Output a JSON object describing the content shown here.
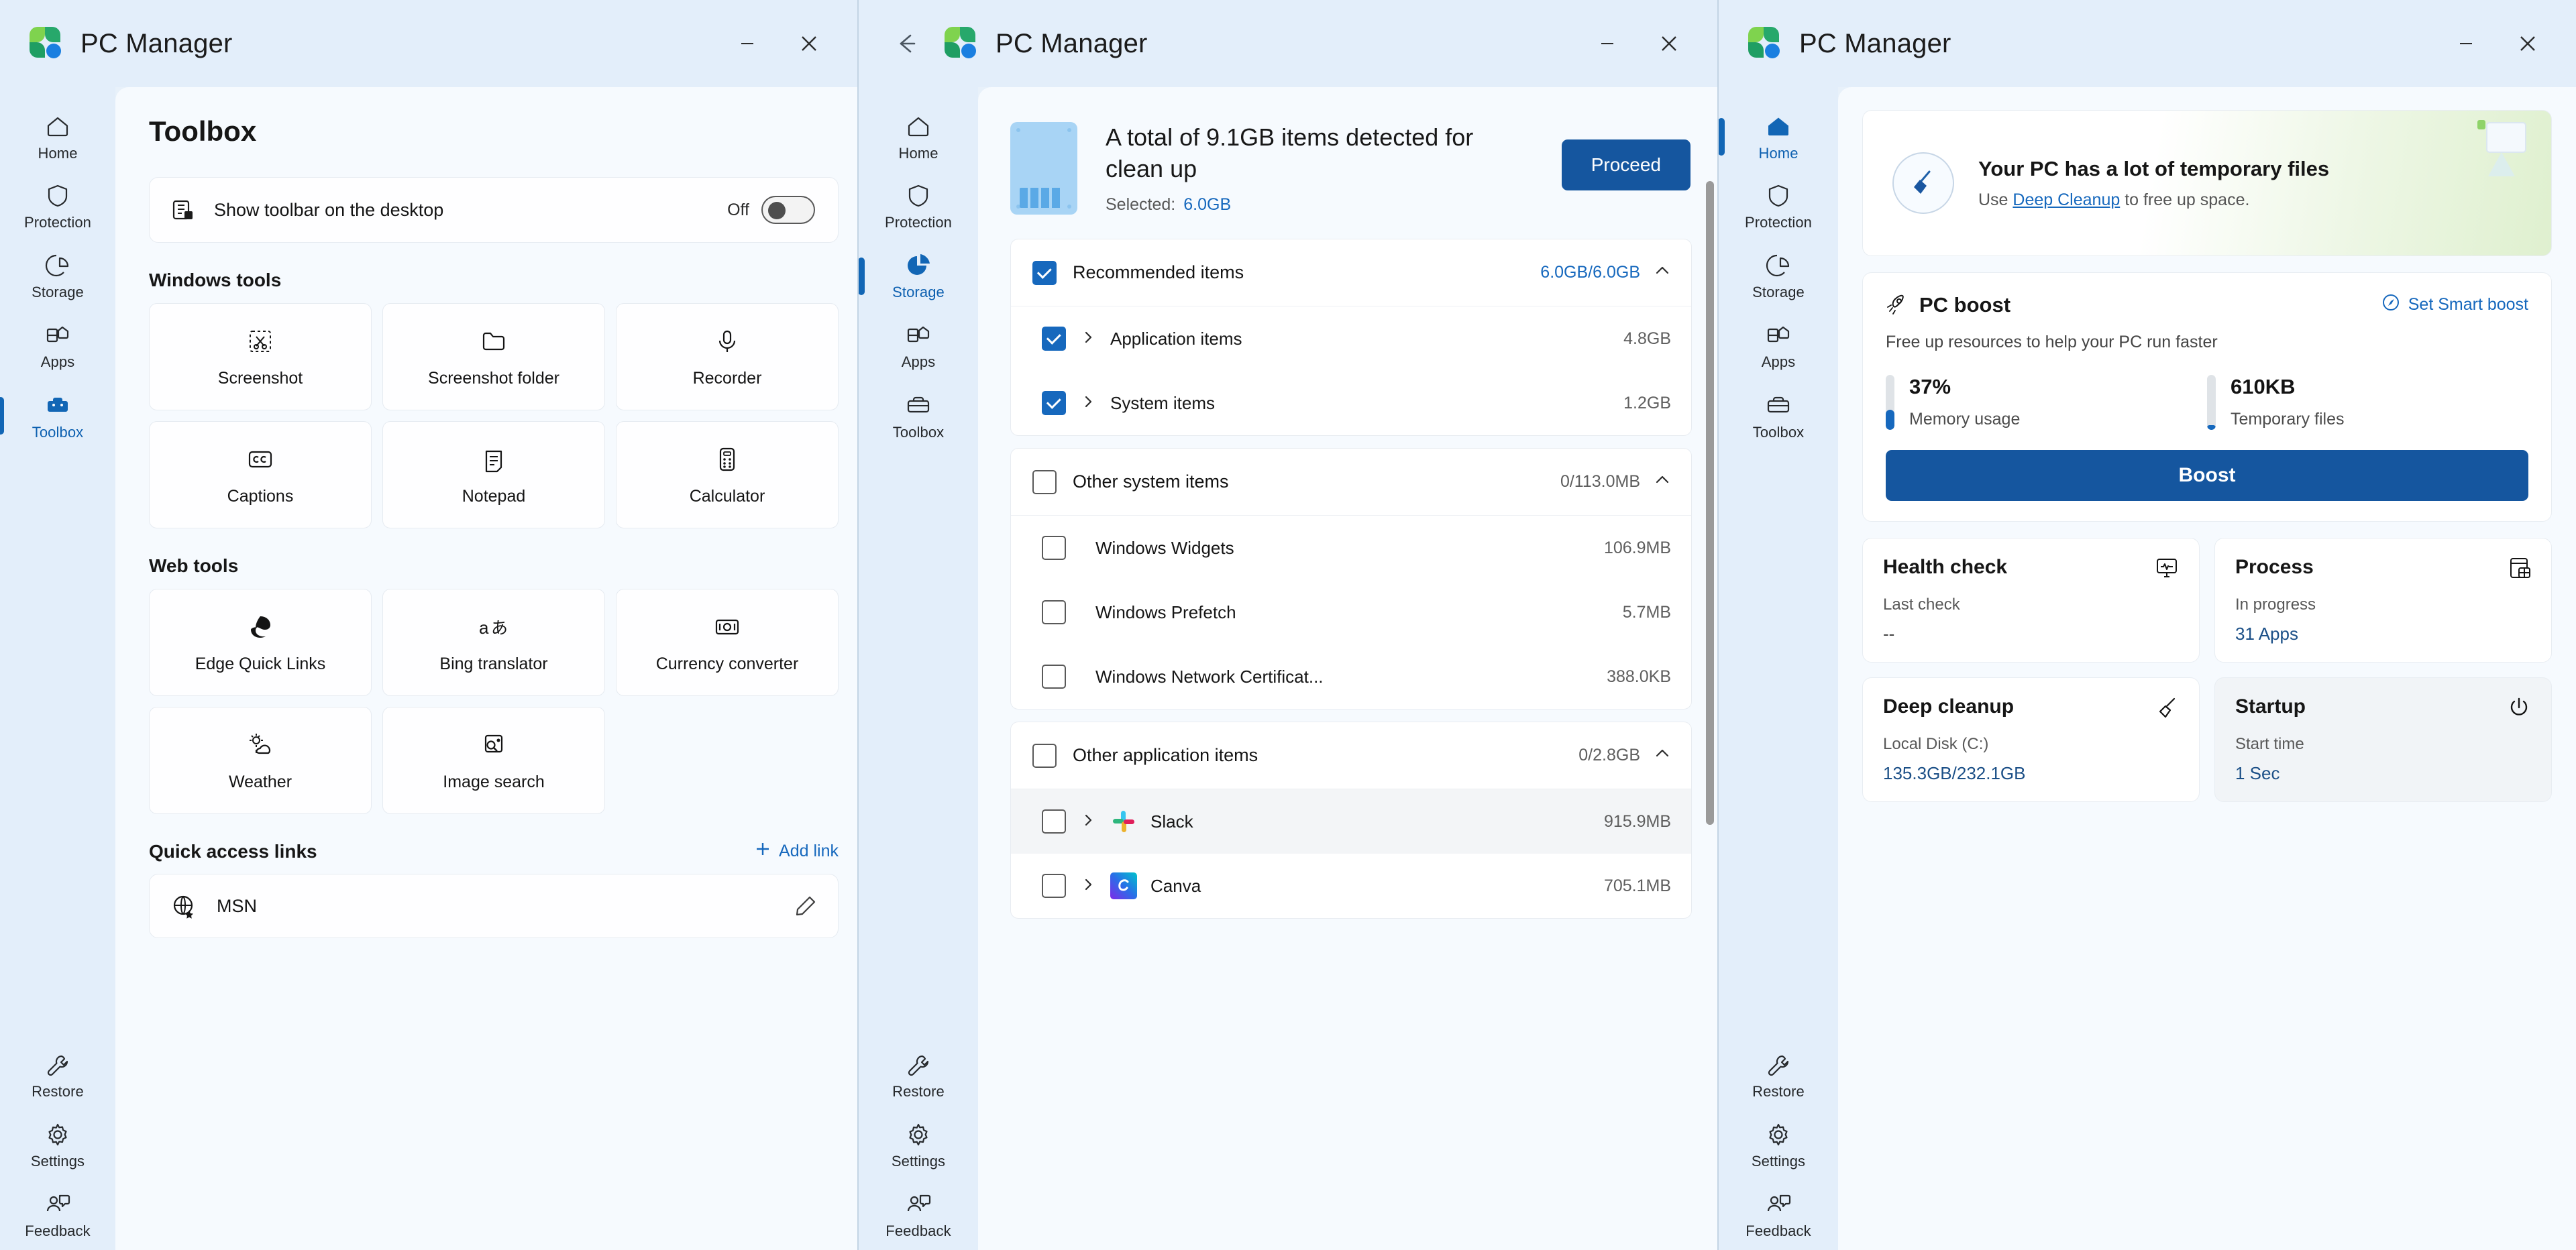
{
  "app": {
    "title": "PC Manager",
    "logo_icon": "pc-manager-logo-icon"
  },
  "window_buttons": {
    "minimize": "minimize-icon",
    "close": "close-icon",
    "back": "back-arrow-icon"
  },
  "nav": {
    "items": [
      {
        "label": "Home",
        "icon": "home-icon"
      },
      {
        "label": "Protection",
        "icon": "shield-icon"
      },
      {
        "label": "Storage",
        "icon": "pie-chart-icon"
      },
      {
        "label": "Apps",
        "icon": "apps-grid-icon"
      },
      {
        "label": "Toolbox",
        "icon": "toolbox-icon"
      }
    ],
    "bottom_items": [
      {
        "label": "Restore",
        "icon": "wrench-icon"
      },
      {
        "label": "Settings",
        "icon": "gear-icon"
      },
      {
        "label": "Feedback",
        "icon": "feedback-icon"
      }
    ]
  },
  "window1": {
    "active_nav": "Toolbox",
    "page_title": "Toolbox",
    "toolbar_setting": {
      "icon": "toolbar-desktop-icon",
      "label": "Show toolbar on the desktop",
      "state_label": "Off",
      "enabled": false
    },
    "windows_tools": {
      "heading": "Windows tools",
      "tiles": [
        {
          "label": "Screenshot",
          "icon": "snip-scissors-icon"
        },
        {
          "label": "Screenshot folder",
          "icon": "folder-icon"
        },
        {
          "label": "Recorder",
          "icon": "microphone-icon"
        },
        {
          "label": "Captions",
          "icon": "closed-captions-icon"
        },
        {
          "label": "Notepad",
          "icon": "notepad-icon"
        },
        {
          "label": "Calculator",
          "icon": "calculator-icon"
        }
      ]
    },
    "web_tools": {
      "heading": "Web tools",
      "tiles": [
        {
          "label": "Edge Quick Links",
          "icon": "edge-browser-icon"
        },
        {
          "label": "Bing translator",
          "icon": "translate-icon"
        },
        {
          "label": "Currency converter",
          "icon": "banknote-icon"
        },
        {
          "label": "Weather",
          "icon": "weather-sun-cloud-icon"
        },
        {
          "label": "Image search",
          "icon": "image-search-icon"
        }
      ]
    },
    "quick_access": {
      "heading": "Quick access links",
      "add_label": "Add link",
      "add_icon": "plus-icon",
      "links": [
        {
          "name": "MSN",
          "icon": "globe-favorite-icon",
          "edit_icon": "pencil-icon"
        }
      ]
    }
  },
  "window2": {
    "active_nav": "Storage",
    "summary": {
      "heading": "A total of 9.1GB items detected for clean up",
      "selected_label": "Selected:",
      "selected_value": "6.0GB",
      "proceed_label": "Proceed",
      "disk_icon": "ssd-drive-icon"
    },
    "groups": [
      {
        "label": "Recommended items",
        "size": "6.0GB/6.0GB",
        "checked": true,
        "size_highlight": true,
        "expanded": true,
        "children": [
          {
            "label": "Application items",
            "size": "4.8GB",
            "checked": true,
            "expandable": true
          },
          {
            "label": "System items",
            "size": "1.2GB",
            "checked": true,
            "expandable": true
          }
        ]
      },
      {
        "label": "Other system items",
        "size": "0/113.0MB",
        "checked": false,
        "size_highlight": false,
        "expanded": true,
        "children": [
          {
            "label": "Windows Widgets",
            "size": "106.9MB",
            "checked": false,
            "expandable": false
          },
          {
            "label": "Windows Prefetch",
            "size": "5.7MB",
            "checked": false,
            "expandable": false
          },
          {
            "label": "Windows Network Certificat...",
            "size": "388.0KB",
            "checked": false,
            "expandable": false
          }
        ]
      },
      {
        "label": "Other application items",
        "size": "0/2.8GB",
        "checked": false,
        "size_highlight": false,
        "expanded": true,
        "children": [
          {
            "label": "Slack",
            "size": "915.9MB",
            "checked": false,
            "expandable": true,
            "app_icon": "slack-icon",
            "hovered": true
          },
          {
            "label": "Canva",
            "size": "705.1MB",
            "checked": false,
            "expandable": true,
            "app_icon": "canva-icon",
            "hovered": false
          }
        ]
      }
    ]
  },
  "window3": {
    "active_nav": "Home",
    "banner": {
      "icon": "broom-icon",
      "title": "Your PC has a lot of temporary files",
      "subtitle_before": "Use ",
      "subtitle_link": "Deep Cleanup",
      "subtitle_after": " to free up space."
    },
    "boost": {
      "icon": "rocket-icon",
      "title": "PC boost",
      "smart_label": "Set Smart boost",
      "smart_icon": "smart-boost-icon",
      "subtitle": "Free up resources to help your PC run faster",
      "metrics": [
        {
          "value": "37%",
          "label": "Memory usage",
          "fill_percent": 37
        },
        {
          "value": "610KB",
          "label": "Temporary files",
          "fill_percent": 8
        }
      ],
      "button_label": "Boost"
    },
    "cards": [
      {
        "title": "Health check",
        "icon": "health-monitor-icon",
        "sub": "Last check",
        "value": "--",
        "value_dim": true,
        "shaded": false
      },
      {
        "title": "Process",
        "icon": "process-window-icon",
        "sub": "In progress",
        "value": "31 Apps",
        "value_dim": false,
        "shaded": false
      },
      {
        "title": "Deep cleanup",
        "icon": "broom-outline-icon",
        "sub": "Local Disk (C:)",
        "value": "135.3GB/232.1GB",
        "value_dim": false,
        "shaded": false
      },
      {
        "title": "Startup",
        "icon": "power-icon",
        "sub": "Start time",
        "value": "1 Sec",
        "value_dim": false,
        "shaded": true
      }
    ]
  },
  "colors": {
    "accent": "#1668bd",
    "button": "#15569f",
    "bg": "#e8f1fa",
    "content_bg": "#f6fafe"
  }
}
